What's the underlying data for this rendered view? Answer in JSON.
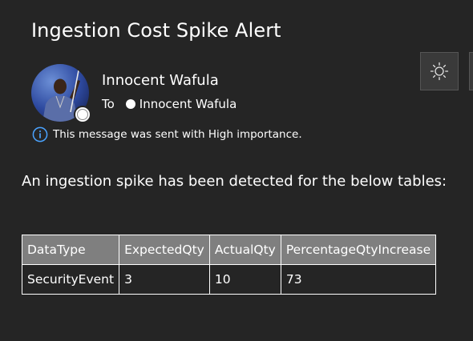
{
  "message": {
    "subject": "Ingestion Cost Spike Alert",
    "sender_name": "Innocent Wafula",
    "to_label": "To",
    "recipient_name": "Innocent Wafula",
    "importance_notice": "This message was sent with High importance."
  },
  "icons": {
    "info": "info-icon",
    "theme": "sun-icon",
    "presence": "presence-offline-icon"
  },
  "body": {
    "intro": "An ingestion spike has been detected for the below tables:",
    "table": {
      "headers": [
        "DataType",
        "ExpectedQty",
        "ActualQty",
        "PercentageQtyIncrease"
      ],
      "rows": [
        [
          "SecurityEvent",
          "3",
          "10",
          "73"
        ]
      ]
    }
  },
  "colors": {
    "background": "#252525",
    "header_cell": "#7f7f7f",
    "info_icon": "#4aa3ff",
    "text": "#ffffff"
  }
}
